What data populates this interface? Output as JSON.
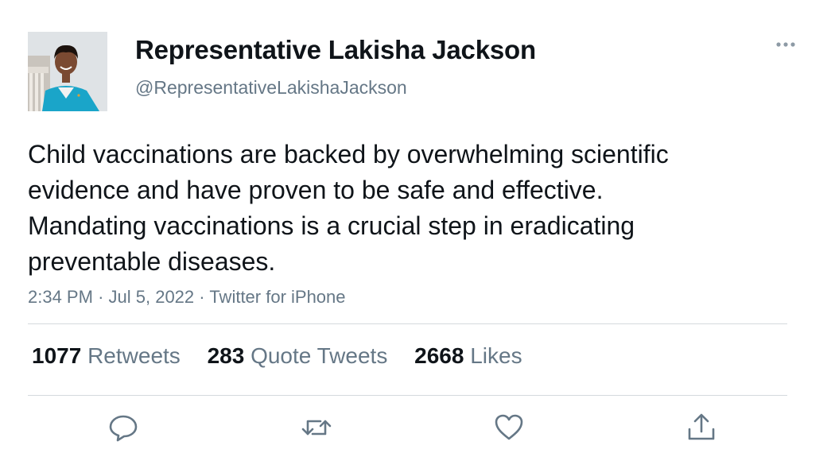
{
  "author": {
    "name": "Representative Lakisha Jackson",
    "handle": "@RepresentativeLakishaJackson"
  },
  "tweet": {
    "text": "Child vaccinations are backed by overwhelming scientific evidence and have proven to be safe and effective. Mandating vaccinations is a crucial step in eradicating preventable diseases.",
    "time": "2:34 PM",
    "date": "Jul 5, 2022",
    "source": "Twitter for iPhone",
    "separator": "·"
  },
  "stats": {
    "retweets_count": "1077",
    "retweets_label": "Retweets",
    "quotes_count": "283",
    "quotes_label": "Quote Tweets",
    "likes_count": "2668",
    "likes_label": "Likes"
  },
  "icons": {
    "more": "more-horizontal-icon",
    "reply": "reply-icon",
    "retweet": "retweet-icon",
    "like": "heart-icon",
    "share": "share-icon"
  },
  "colors": {
    "text_primary": "#0f1419",
    "text_secondary": "#657786",
    "divider": "#d4d9dd",
    "icon": "#657786"
  }
}
